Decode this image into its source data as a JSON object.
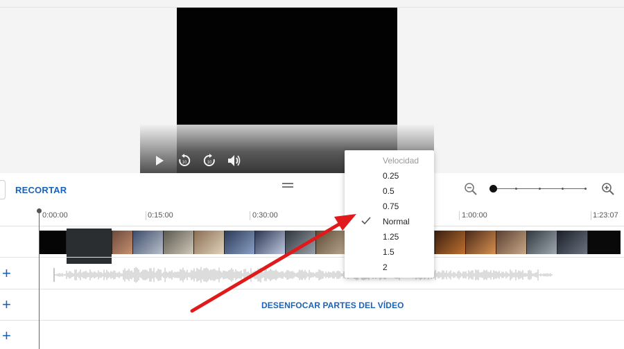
{
  "player": {
    "controls": [
      "play-icon",
      "rewind-10-icon",
      "forward-10-icon",
      "volume-icon"
    ]
  },
  "toolbar": {
    "trim_label": "RECORTAR"
  },
  "zoom": {
    "level": 0
  },
  "timeline": {
    "time_labels": [
      "0:00:00",
      "0:15:00",
      "0:30:00",
      "1:00:00",
      "1:23:07"
    ]
  },
  "tracks": {
    "blur_label": "DESENFOCAR PARTES DEL VÍDEO",
    "add_symbol": "+"
  },
  "speed_menu": {
    "header": "Velocidad",
    "options": [
      "0.25",
      "0.5",
      "0.75",
      "Normal",
      "1.25",
      "1.5",
      "2"
    ],
    "selected": "Normal"
  },
  "colors": {
    "accent": "#1a62b8",
    "arrow": "#e0191b"
  }
}
